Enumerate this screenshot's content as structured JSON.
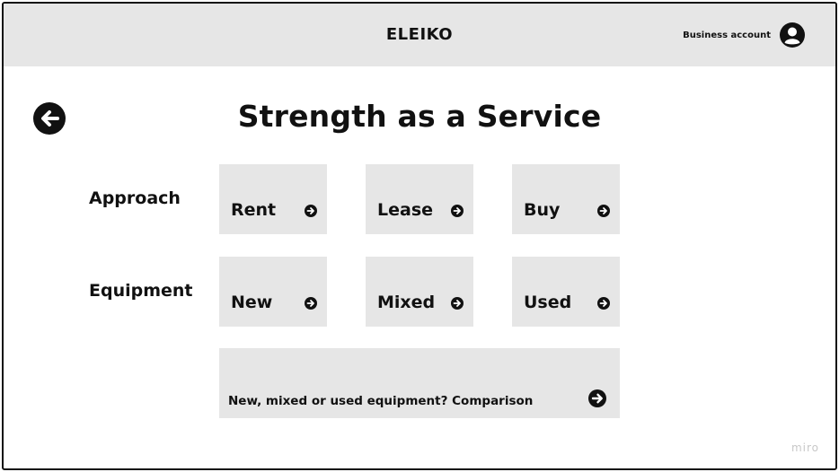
{
  "header": {
    "brand": "ELEIKO",
    "account_label": "Business account",
    "account_icon": "user-avatar-icon",
    "background": "#e6e6e6"
  },
  "page": {
    "title": "Strength as a Service",
    "back_icon": "arrow-left-circle-icon"
  },
  "approach": {
    "label": "Approach",
    "options": [
      {
        "label": "Rent",
        "icon": "arrow-right-circle-icon"
      },
      {
        "label": "Lease",
        "icon": "arrow-right-circle-icon"
      },
      {
        "label": "Buy",
        "icon": "arrow-right-circle-icon"
      }
    ]
  },
  "equipment": {
    "label": "Equipment",
    "options": [
      {
        "label": "New",
        "icon": "arrow-right-circle-icon"
      },
      {
        "label": "Mixed",
        "icon": "arrow-right-circle-icon"
      },
      {
        "label": "Used",
        "icon": "arrow-right-circle-icon"
      }
    ]
  },
  "comparison": {
    "label": "New, mixed or used equipment? Comparison",
    "icon": "arrow-right-circle-icon"
  },
  "watermark": "miro",
  "colors": {
    "tile": "#e6e6e6",
    "text": "#111111",
    "watermark": "#c8c8c8"
  }
}
